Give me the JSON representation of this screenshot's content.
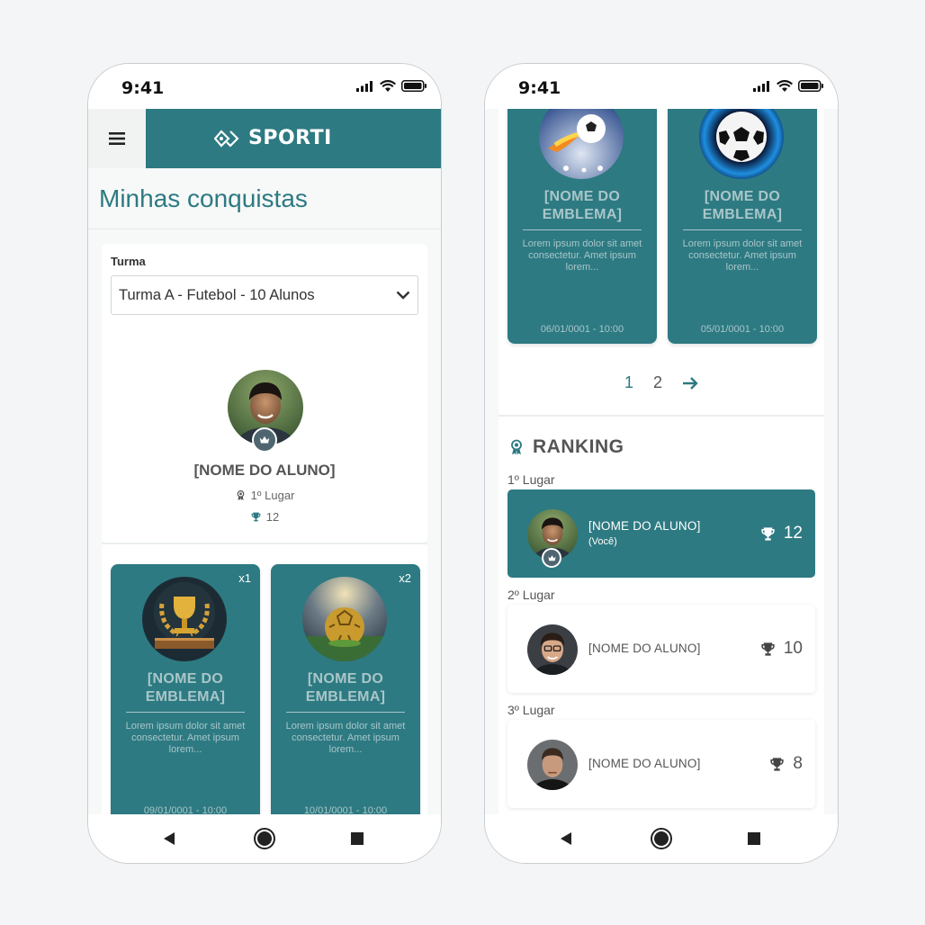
{
  "colors": {
    "accent": "#2d7a82",
    "badge_text": "#a9c6c9",
    "crown_bg": "#4f6670"
  },
  "status_bar": {
    "time": "9:41"
  },
  "left": {
    "brand": "SPORTI",
    "page_title": "Minhas conquistas",
    "turma_label": "Turma",
    "turma_value": "Turma A - Futebol - 10 Alunos",
    "student_name": "[NOME DO ALUNO]",
    "rank_text": "1º Lugar",
    "trophies": "12",
    "badges": [
      {
        "mult": "x1",
        "name": "[NOME DO EMBLEMA]",
        "desc": "Lorem ipsum dolor sit amet consectetur. Amet ipsum lorem...",
        "date": "09/01/0001 - 10:00",
        "icon": "trophy-laurel-icon"
      },
      {
        "mult": "x2",
        "name": "[NOME DO EMBLEMA]",
        "desc": "Lorem ipsum dolor sit amet consectetur. Amet ipsum lorem...",
        "date": "10/01/0001 - 10:00",
        "icon": "golden-ball-icon"
      }
    ]
  },
  "right": {
    "badges": [
      {
        "name": "[NOME DO EMBLEMA]",
        "desc": "Lorem ipsum dolor sit amet consectetur. Amet ipsum lorem...",
        "date": "06/01/0001 - 10:00",
        "icon": "fire-ball-icon"
      },
      {
        "name": "[NOME DO EMBLEMA]",
        "desc": "Lorem ipsum dolor sit amet consectetur. Amet ipsum lorem...",
        "date": "05/01/0001 - 10:00",
        "icon": "soccer-ball-icon"
      }
    ],
    "pagination": {
      "page1": "1",
      "page2": "2"
    },
    "ranking_title": "RANKING",
    "ranking": [
      {
        "place": "1º Lugar",
        "name": "[NOME DO ALUNO]",
        "you": "(Você)",
        "score": "12"
      },
      {
        "place": "2º Lugar",
        "name": "[NOME DO ALUNO]",
        "score": "10"
      },
      {
        "place": "3º Lugar",
        "name": "[NOME DO ALUNO]",
        "score": "8"
      }
    ]
  }
}
